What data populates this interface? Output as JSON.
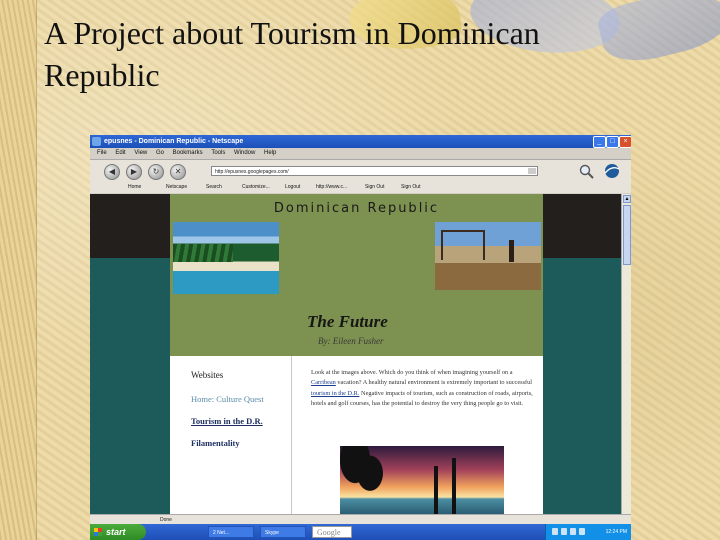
{
  "slide": {
    "title": "A Project about Tourism in Dominican Republic"
  },
  "browser": {
    "window_title": "epusnes - Dominican Republic - Netscape",
    "menu": [
      "File",
      "Edit",
      "View",
      "Go",
      "Bookmarks",
      "Tools",
      "Window",
      "Help"
    ],
    "url": "http://epusnes.googlepages.com/",
    "bookmarks": [
      "Home",
      "Netscape",
      "Search",
      "Customize...",
      "Logout",
      "http://www.c...",
      "Sign Out",
      "Sign Out"
    ],
    "status_text": "Done",
    "window_controls": {
      "minimize": "_",
      "maximize": "□",
      "close": "×"
    }
  },
  "page": {
    "site_title": "Dominican Republic",
    "heading": "The Future",
    "byline": "By: Eileen Fusher",
    "nav": {
      "header": "Websites",
      "links": [
        "Home: Culture Quest",
        "Tourism in the D.R.",
        "Filamentality"
      ]
    },
    "body": {
      "t1": "Look at the images above. Which do you think of when imagining yourself on a ",
      "link1": "Carribean",
      "t2": " vacation? A healthy natural environment is extremely important to successful ",
      "link2": "tourism in the D.R.",
      "t3": " Negative impacts of tourism, such as construction of roads, airports, hotels and golf courses, has the potential to destroy the very thing people go to visit."
    }
  },
  "taskbar": {
    "start_label": "start",
    "tasks": [
      "2 Net...",
      "Skype",
      "Google"
    ],
    "clock": "12:24 PM"
  },
  "colors": {
    "banner": "#7d9150",
    "teal_background": "#1d5a5a",
    "title_bar": "#1c4fb8"
  }
}
